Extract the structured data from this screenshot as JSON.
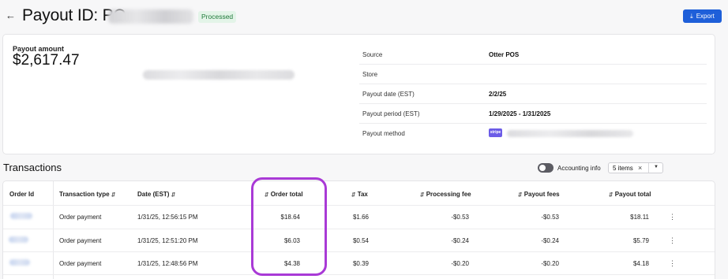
{
  "header": {
    "back_icon": "arrow-left-icon",
    "title": "Payout ID: PO-",
    "status": "Processed",
    "export_label": "Export",
    "export_icon": "download-icon",
    "accent_color": "#1e5fd9",
    "status_color": "#1f7a3a"
  },
  "summary": {
    "amount_label": "Payout amount",
    "amount_value": "$2,617.47",
    "details": [
      {
        "key": "Source",
        "value": "Otter POS"
      },
      {
        "key": "Store",
        "value": ""
      },
      {
        "key": "Payout date (EST)",
        "value": "2/2/25"
      },
      {
        "key": "Payout period (EST)",
        "value": "1/29/2025 - 1/31/2025"
      },
      {
        "key": "Payout method",
        "value": "",
        "logo_text": "stripe"
      }
    ]
  },
  "transactions": {
    "title": "Transactions",
    "toggle_label": "Accounting info",
    "items_chip": "5 items",
    "columns": [
      "Order Id",
      "Transaction type",
      "Date (EST)",
      "Order total",
      "Tax",
      "Processing fee",
      "Payout fees",
      "Payout total"
    ],
    "rows": [
      {
        "type": "Order payment",
        "date": "1/31/25, 12:56:15 PM",
        "order_total": "$18.64",
        "tax": "$1.66",
        "processing_fee": "-$0.53",
        "payout_fees": "-$0.53",
        "payout_total": "$18.11"
      },
      {
        "type": "Order payment",
        "date": "1/31/25, 12:51:20 PM",
        "order_total": "$6.03",
        "tax": "$0.54",
        "processing_fee": "-$0.24",
        "payout_fees": "-$0.24",
        "payout_total": "$5.79"
      },
      {
        "type": "Order payment",
        "date": "1/31/25, 12:48:56 PM",
        "order_total": "$4.38",
        "tax": "$0.39",
        "processing_fee": "-$0.20",
        "payout_fees": "-$0.20",
        "payout_total": "$4.18"
      }
    ]
  },
  "highlight_color": "#a93ad6"
}
